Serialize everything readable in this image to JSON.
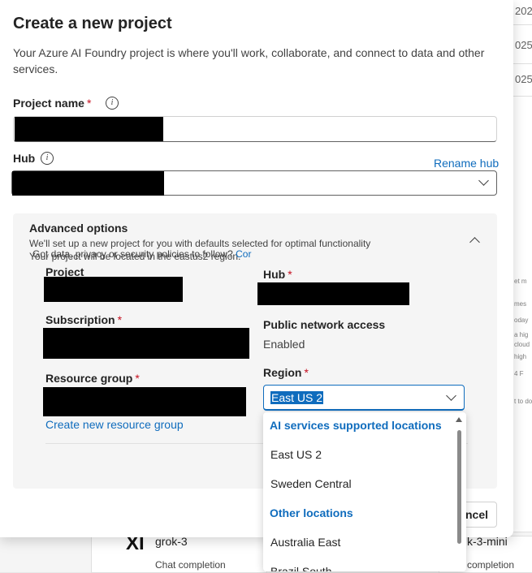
{
  "background": {
    "dates": [
      "202",
      "025",
      "025"
    ],
    "snippets": [
      "et m",
      "mes",
      "oday",
      "a hig",
      "cloud",
      "high",
      "4 F",
      "t to do"
    ],
    "cards": [
      {
        "name": "grok-3",
        "subtitle": "Chat completion",
        "logo": "XI"
      },
      {
        "name": "k-3-mini",
        "subtitle": "completion"
      }
    ]
  },
  "dialog": {
    "title": "Create a new project",
    "description": "Your Azure AI Foundry project is where you'll work, collaborate, and connect to data and other services.",
    "project_name_label": "Project name",
    "required_mark": "*",
    "hub_label": "Hub",
    "rename_hub_link": "Rename hub",
    "advanced": {
      "title": "Advanced options",
      "line1": "We'll set up a new project for you with defaults selected for optimal functionality",
      "line2": "Your project will be located in the eastus2 region.",
      "project_label": "Project",
      "hub_label": "Hub",
      "subscription_label": "Subscription",
      "public_network_label": "Public network access",
      "public_network_value": "Enabled",
      "resource_group_label": "Resource group",
      "region_label": "Region",
      "region_value": "East US 2",
      "create_rg_link": "Create new resource group",
      "footnote": "Got data, privacy or security policies to follow?",
      "footnote_link": "Cor"
    },
    "cancel_label": "ncel"
  },
  "region_dropdown": {
    "group1": "AI services supported locations",
    "group1_items": [
      "East US 2",
      "Sweden Central"
    ],
    "group2": "Other locations",
    "group2_items": [
      "Australia East",
      "Brazil South"
    ]
  },
  "icons": [
    "info-icon",
    "chevron-down-icon",
    "chevron-up-icon",
    "scroll-up-icon"
  ]
}
